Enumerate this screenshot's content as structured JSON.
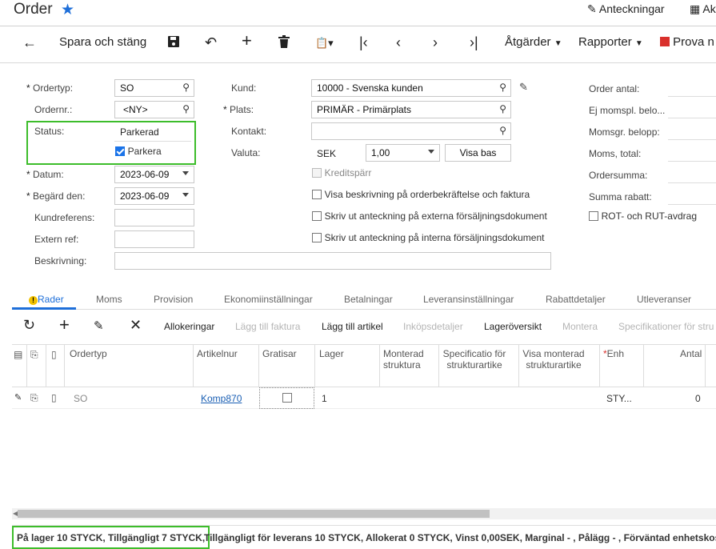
{
  "header": {
    "title": "Order",
    "notes_label": "Anteckningar",
    "activities_label": "Ak"
  },
  "toolbar": {
    "save_close": "Spara och stäng",
    "actions": "Åtgärder",
    "reports": "Rapporter",
    "try": "Prova n"
  },
  "form": {
    "order_type": {
      "label": "Ordertyp:",
      "value": "SO"
    },
    "order_nbr": {
      "label": "Ordernr.:",
      "value": "<NY>"
    },
    "status": {
      "label": "Status:",
      "value": "Parkerad"
    },
    "hold": {
      "label": "Parkera",
      "checked": true
    },
    "date": {
      "label": "Datum:",
      "value": "2023-06-09"
    },
    "requested_on": {
      "label": "Begärd den:",
      "value": "2023-06-09"
    },
    "customer_ref": {
      "label": "Kundreferens:",
      "value": ""
    },
    "external_ref": {
      "label": "Extern ref:",
      "value": ""
    },
    "description": {
      "label": "Beskrivning:",
      "value": ""
    },
    "customer": {
      "label": "Kund:",
      "value": "10000 - Svenska kunden"
    },
    "location": {
      "label": "Plats:",
      "value": "PRIMÄR - Primärplats"
    },
    "contact": {
      "label": "Kontakt:",
      "value": ""
    },
    "currency": {
      "label": "Valuta:",
      "code": "SEK",
      "rate": "1,00",
      "base_button": "Visa bas"
    },
    "credit_hold": {
      "label": "Kreditspärr",
      "checked": false
    },
    "show_desc": {
      "label": "Visa beskrivning på orderbekräftelse och faktura",
      "checked": false
    },
    "print_ext": {
      "label": "Skriv ut anteckning på externa försäljningsdokument",
      "checked": false
    },
    "print_int": {
      "label": "Skriv ut anteckning på interna försäljningsdokument",
      "checked": false
    },
    "totals": [
      "Order antal:",
      "Ej momspl. belo...",
      "Momsgr. belopp:",
      "Moms, total:",
      "Ordersumma:",
      "Summa rabatt:"
    ],
    "rot_rut": {
      "label": "ROT- och RUT-avdrag",
      "checked": false
    }
  },
  "tabs": [
    "Rader",
    "Moms",
    "Provision",
    "Ekonomiinställningar",
    "Betalningar",
    "Leveransinställningar",
    "Rabattdetaljer",
    "Utleveranser"
  ],
  "grid_toolbar": {
    "allocations": "Allokeringar",
    "add_invoice": "Lägg till faktura",
    "add_item": "Lägg till artikel",
    "purchase_details": "Inköpsdetaljer",
    "inventory_summary": "Lageröversikt",
    "assemble": "Montera",
    "specs": "Specifikationer för stru"
  },
  "grid": {
    "columns": {
      "ordertype": "Ordertyp",
      "item": "Artikelnur",
      "free": "Gratisar",
      "warehouse": "Lager",
      "assembled": "Monterad struktura",
      "spec": "Specificatio för strukturartike",
      "show_assembled": "Visa monterad strukturartike",
      "uom": "Enh",
      "qty": "Antal"
    },
    "rows": [
      {
        "ordertype": "SO",
        "item": "Komp870",
        "free": false,
        "warehouse": "1",
        "uom": "STY...",
        "qty": "0"
      }
    ]
  },
  "status_bar": {
    "highlighted": "På lager 10 STYCK, Tillgängligt 7 STYCK,",
    "rest": " Tillgängligt för leverans 10 STYCK, Allokerat 0 STYCK, Vinst 0,00SEK, Marginal - , Pålägg - , Förväntad enhetskostnad"
  },
  "colors": {
    "accent": "#1e6fd9",
    "highlight": "#3dbd2b"
  }
}
